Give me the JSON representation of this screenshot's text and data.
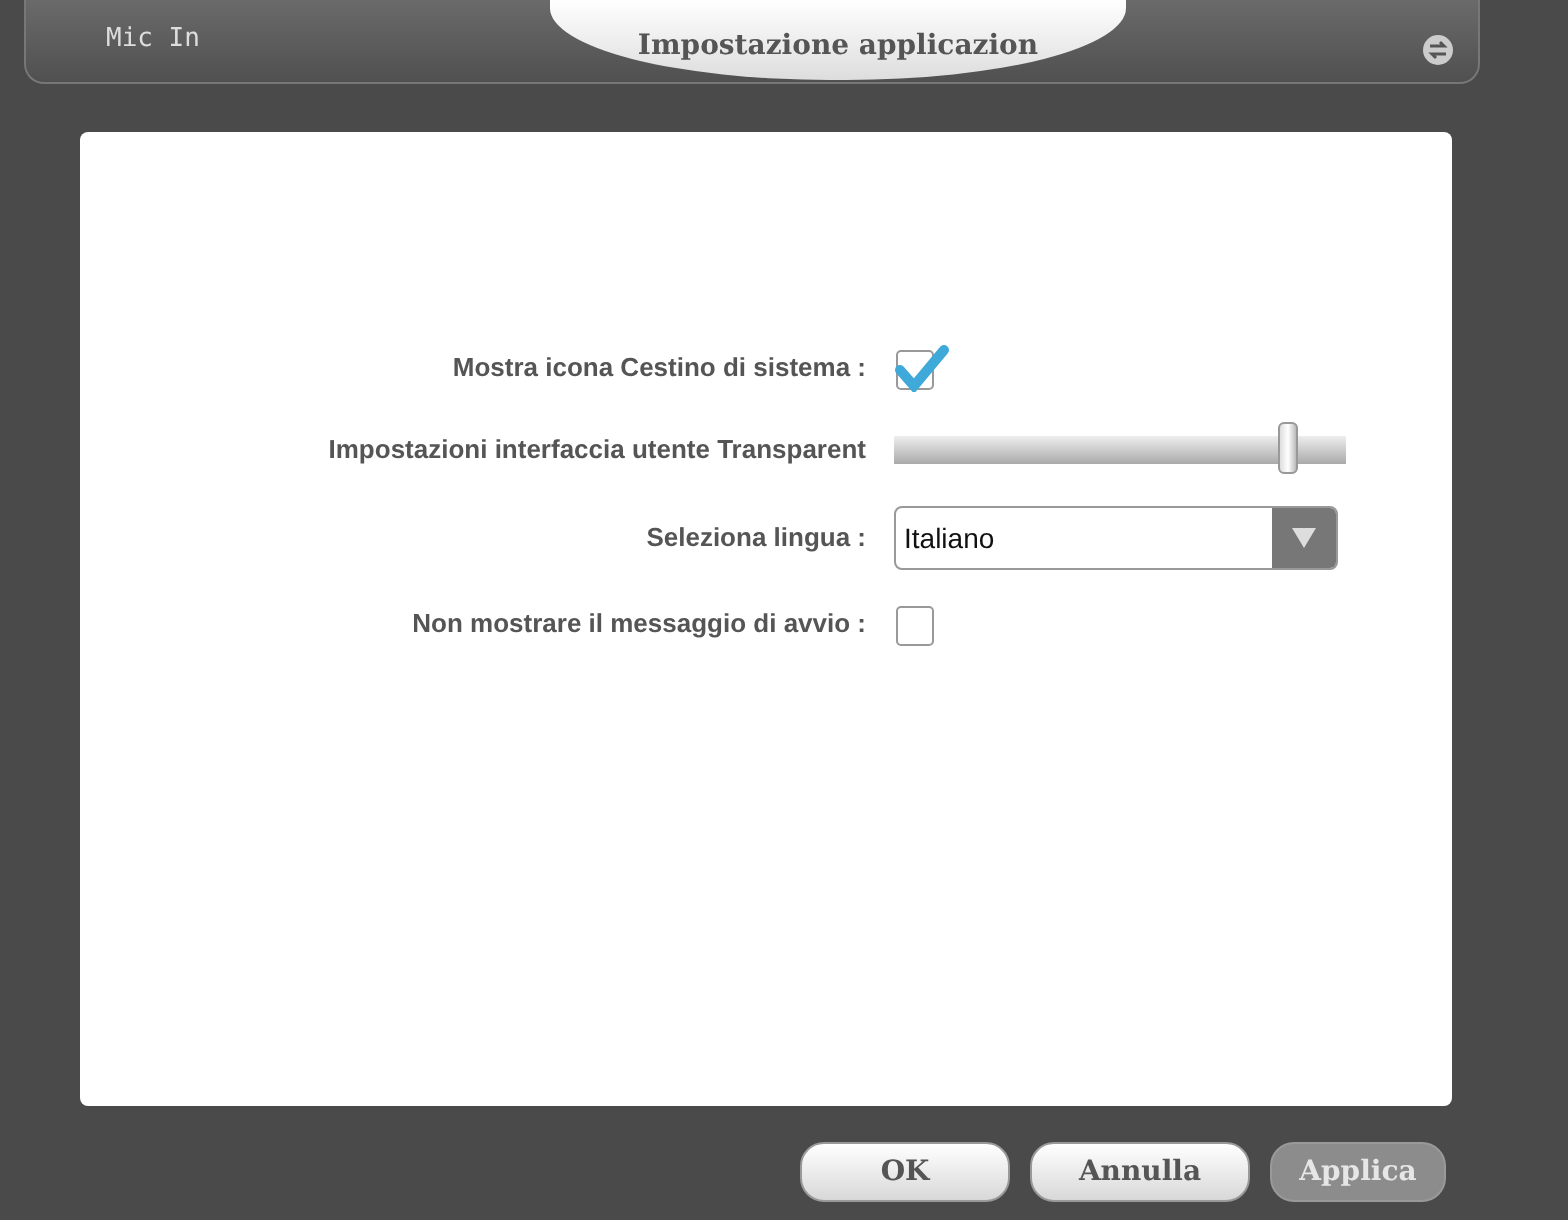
{
  "header": {
    "source_label": "Mic In",
    "title": "Impostazione applicazion"
  },
  "settings": [
    {
      "kind": "checkbox",
      "label": "Mostra icona Cestino di sistema :",
      "checked": true
    },
    {
      "kind": "slider",
      "label": "Impostazioni interfaccia utente Transparent",
      "level": 0.87
    },
    {
      "kind": "select",
      "label": "Seleziona lingua :",
      "value": "Italiano"
    },
    {
      "kind": "checkbox",
      "label": "Non mostrare il messaggio di avvio :",
      "checked": false
    }
  ],
  "buttons": [
    {
      "label": "OK",
      "disabled": false
    },
    {
      "label": "Annulla",
      "disabled": false
    },
    {
      "label": "Applica",
      "disabled": true
    }
  ]
}
